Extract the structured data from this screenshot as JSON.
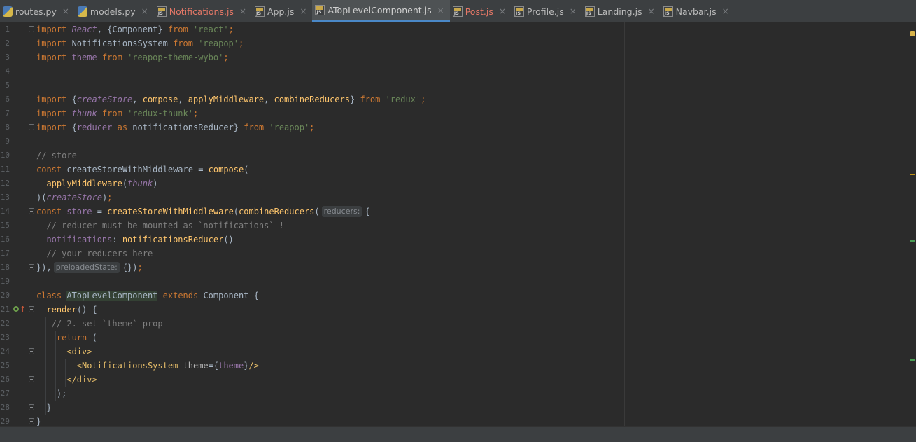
{
  "tabs": [
    {
      "label": "routes.py",
      "type": "py",
      "state": "normal",
      "close": "×"
    },
    {
      "label": "models.py",
      "type": "py",
      "state": "normal",
      "close": "×"
    },
    {
      "label": "Notifications.js",
      "type": "js",
      "state": "error",
      "close": "×"
    },
    {
      "label": "App.js",
      "type": "js",
      "state": "normal",
      "close": "×"
    },
    {
      "label": "ATopLevelComponent.js",
      "type": "js",
      "state": "active",
      "close": "×"
    },
    {
      "label": "Post.js",
      "type": "js",
      "state": "error",
      "close": "×"
    },
    {
      "label": "Profile.js",
      "type": "js",
      "state": "normal",
      "close": "×"
    },
    {
      "label": "Landing.js",
      "type": "js",
      "state": "normal",
      "close": "×"
    },
    {
      "label": "Navbar.js",
      "type": "js",
      "state": "normal",
      "close": "×"
    }
  ],
  "editor": {
    "lines": [
      {
        "n": "1",
        "fold": true,
        "tokens": [
          [
            "kw",
            "import "
          ],
          [
            "cls",
            "React"
          ],
          [
            "id",
            ", {Component} "
          ],
          [
            "kw",
            "from "
          ],
          [
            "str",
            "'react'"
          ],
          [
            "kw",
            ";"
          ]
        ]
      },
      {
        "n": "2",
        "tokens": [
          [
            "kw",
            "import "
          ],
          [
            "id",
            "NotificationsSystem "
          ],
          [
            "kw",
            "from "
          ],
          [
            "str",
            "'reapop'"
          ],
          [
            "kw",
            ";"
          ]
        ]
      },
      {
        "n": "3",
        "tokens": [
          [
            "kw",
            "import "
          ],
          [
            "vr",
            "theme "
          ],
          [
            "kw",
            "from "
          ],
          [
            "str",
            "'reapop-theme-wybo'"
          ],
          [
            "kw",
            ";"
          ]
        ]
      },
      {
        "n": "4",
        "tokens": []
      },
      {
        "n": "5",
        "tokens": []
      },
      {
        "n": "6",
        "tokens": [
          [
            "kw",
            "import "
          ],
          [
            "id",
            "{"
          ],
          [
            "cls",
            "createStore"
          ],
          [
            "id",
            ", "
          ],
          [
            "fn",
            "compose"
          ],
          [
            "id",
            ", "
          ],
          [
            "fn",
            "applyMiddleware"
          ],
          [
            "id",
            ", "
          ],
          [
            "fn",
            "combineReducers"
          ],
          [
            "id",
            "} "
          ],
          [
            "kw",
            "from "
          ],
          [
            "str",
            "'redux'"
          ],
          [
            "kw",
            ";"
          ]
        ]
      },
      {
        "n": "7",
        "tokens": [
          [
            "kw",
            "import "
          ],
          [
            "cls",
            "thunk "
          ],
          [
            "kw",
            "from "
          ],
          [
            "str",
            "'redux-thunk'"
          ],
          [
            "kw",
            ";"
          ]
        ]
      },
      {
        "n": "8",
        "fold": true,
        "tokens": [
          [
            "kw",
            "import "
          ],
          [
            "id",
            "{"
          ],
          [
            "vr",
            "reducer "
          ],
          [
            "kw",
            "as "
          ],
          [
            "id",
            "notificationsReducer} "
          ],
          [
            "kw",
            "from "
          ],
          [
            "str",
            "'reapop'"
          ],
          [
            "kw",
            ";"
          ]
        ]
      },
      {
        "n": "9",
        "tokens": []
      },
      {
        "n": "10",
        "tokens": [
          [
            "cm",
            "// store"
          ]
        ]
      },
      {
        "n": "11",
        "tokens": [
          [
            "kw",
            "const "
          ],
          [
            "id",
            "createStoreWithMiddleware = "
          ],
          [
            "fn",
            "compose"
          ],
          [
            "id",
            "("
          ]
        ]
      },
      {
        "n": "12",
        "tokens": [
          [
            "id",
            "  "
          ],
          [
            "fn",
            "applyMiddleware"
          ],
          [
            "id",
            "("
          ],
          [
            "cls",
            "thunk"
          ],
          [
            "id",
            ")"
          ]
        ]
      },
      {
        "n": "13",
        "tokens": [
          [
            "id",
            ")("
          ],
          [
            "cls",
            "createStore"
          ],
          [
            "id",
            ")"
          ],
          [
            "kw",
            ";"
          ]
        ]
      },
      {
        "n": "14",
        "fold": true,
        "tokens": [
          [
            "kw",
            "const "
          ],
          [
            "vr",
            "store "
          ],
          [
            "id",
            "= "
          ],
          [
            "fn",
            "createStoreWithMiddleware"
          ],
          [
            "id",
            "("
          ],
          [
            "fn",
            "combineReducers"
          ],
          [
            "id",
            "("
          ],
          [
            "hint",
            "reducers:"
          ],
          [
            "id",
            "{"
          ]
        ]
      },
      {
        "n": "15",
        "tokens": [
          [
            "cm",
            "  // reducer must be mounted as `notifications` !"
          ]
        ]
      },
      {
        "n": "16",
        "tokens": [
          [
            "id",
            "  "
          ],
          [
            "vr",
            "notifications"
          ],
          [
            "id",
            ": "
          ],
          [
            "fn",
            "notificationsReducer"
          ],
          [
            "id",
            "()"
          ]
        ]
      },
      {
        "n": "17",
        "tokens": [
          [
            "cm",
            "  // your reducers here"
          ]
        ]
      },
      {
        "n": "18",
        "fold": true,
        "tokens": [
          [
            "id",
            "}),"
          ],
          [
            "hint",
            "preloadedState:"
          ],
          [
            "id",
            "{})"
          ],
          [
            "kw",
            ";"
          ]
        ]
      },
      {
        "n": "19",
        "tokens": []
      },
      {
        "n": "20",
        "tokens": [
          [
            "kw",
            "class "
          ],
          [
            "hl",
            "ATopLevelComponent"
          ],
          [
            "id",
            " "
          ],
          [
            "kw",
            "extends "
          ],
          [
            "id",
            "Component {"
          ]
        ]
      },
      {
        "n": "21",
        "fold": true,
        "override": true,
        "tokens": [
          [
            "id",
            "  "
          ],
          [
            "fn",
            "render"
          ],
          [
            "id",
            "() {"
          ]
        ]
      },
      {
        "n": "22",
        "tokens": [
          [
            "cm",
            "   // 2. set `theme` prop"
          ]
        ]
      },
      {
        "n": "23",
        "tokens": [
          [
            "id",
            "    "
          ],
          [
            "kw",
            "return "
          ],
          [
            "id",
            "("
          ]
        ]
      },
      {
        "n": "24",
        "fold": true,
        "tokens": [
          [
            "id",
            "      "
          ],
          [
            "tag",
            "<div>"
          ]
        ]
      },
      {
        "n": "25",
        "tokens": [
          [
            "id",
            "        "
          ],
          [
            "tag",
            "<NotificationsSystem "
          ],
          [
            "attr",
            "theme"
          ],
          [
            "id",
            "={"
          ],
          [
            "vr",
            "theme"
          ],
          [
            "id",
            "}"
          ],
          [
            "tag",
            "/>"
          ]
        ]
      },
      {
        "n": "26",
        "fold": true,
        "tokens": [
          [
            "id",
            "      "
          ],
          [
            "tag",
            "</div>"
          ]
        ]
      },
      {
        "n": "27",
        "tokens": [
          [
            "id",
            "    );"
          ]
        ]
      },
      {
        "n": "28",
        "fold": true,
        "tokens": [
          [
            "id",
            "  }"
          ]
        ]
      },
      {
        "n": "29",
        "fold": true,
        "tokens": [
          [
            "id",
            "}"
          ]
        ]
      }
    ]
  },
  "scroll_markers": [
    {
      "kind": "check",
      "top": 0.02
    },
    {
      "kind": "warn",
      "top": 0.375
    },
    {
      "kind": "ok",
      "top": 0.54
    },
    {
      "kind": "ok",
      "top": 0.835
    }
  ],
  "colors": {
    "background": "#2b2b2b",
    "keyword": "#cc7832",
    "string": "#6a8759",
    "function": "#ffc66d",
    "variable": "#9876aa",
    "comment": "#808080",
    "active_tab_underline": "#4a88c7"
  },
  "icons": {
    "js_file": "js-file-icon",
    "py_file": "python-file-icon",
    "close": "close-icon",
    "fold": "fold-marker-icon",
    "override": "override-method-icon"
  }
}
